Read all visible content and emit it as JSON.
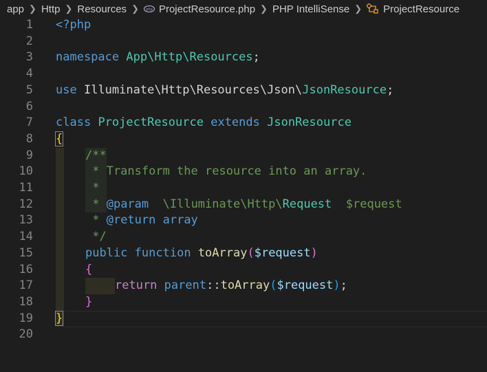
{
  "breadcrumb": {
    "items": [
      "app",
      "Http",
      "Resources",
      "ProjectResource.php",
      "PHP IntelliSense",
      "ProjectResource"
    ],
    "icons": [
      "php-file-icon",
      "class-icon"
    ]
  },
  "lines": {
    "numbers": [
      "1",
      "2",
      "3",
      "4",
      "5",
      "6",
      "7",
      "8",
      "9",
      "10",
      "11",
      "12",
      "13",
      "14",
      "15",
      "16",
      "17",
      "18",
      "19",
      "20"
    ],
    "l1": {
      "open_tag": "<?php"
    },
    "l3": {
      "kw": "namespace",
      "ns": "App\\Http\\Resources",
      "semi": ";"
    },
    "l5": {
      "kw": "use",
      "path": "Illuminate\\Http\\Resources\\Json\\",
      "cls": "JsonResource",
      "semi": ";"
    },
    "l7": {
      "kw": "class",
      "name": "ProjectResource",
      "ext": "extends",
      "parent": "JsonResource"
    },
    "l8": {
      "brace": "{"
    },
    "l9": {
      "comment": "/**"
    },
    "l10": {
      "comment": " * Transform the resource into an array."
    },
    "l11": {
      "comment": " *"
    },
    "l12": {
      "star": " * ",
      "tag": "@param",
      "pad": "  ",
      "path": "\\Illuminate\\Http\\",
      "cls": "Request",
      "var": "  $request"
    },
    "l13": {
      "star": " * ",
      "tag": "@return",
      "type": " array"
    },
    "l14": {
      "comment": " */"
    },
    "l15": {
      "kw1": "public",
      "kw2": "function",
      "fn": "toArray",
      "open": "(",
      "var": "$request",
      "close": ")"
    },
    "l16": {
      "brace": "{"
    },
    "l17": {
      "ret": "return",
      "parent": "parent",
      "op": "::",
      "fn": "toArray",
      "open": "(",
      "var": "$request",
      "close": ")",
      "semi": ";"
    },
    "l18": {
      "brace": "}"
    },
    "l19": {
      "brace": "}"
    }
  }
}
